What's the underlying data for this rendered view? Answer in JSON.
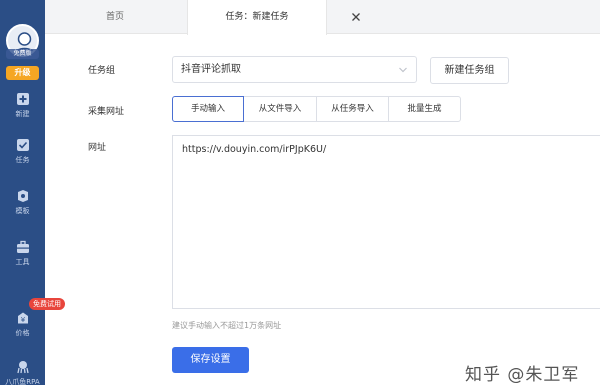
{
  "sidebar": {
    "avatar_tag": "免费版",
    "upgrade_label": "升级",
    "items": [
      {
        "label": "新建",
        "icon": "plus-square-icon"
      },
      {
        "label": "任务",
        "icon": "task-check-icon"
      },
      {
        "label": "模板",
        "icon": "template-icon"
      },
      {
        "label": "工具",
        "icon": "toolbox-icon"
      },
      {
        "label": "价格",
        "icon": "price-icon"
      },
      {
        "label": "八爪鱼RPA",
        "icon": "rpa-octopus-icon"
      }
    ],
    "free_trial_badge": "免费试用"
  },
  "tabs": {
    "home": "首页",
    "active": "任务：新建任务",
    "close_icon": "close-icon"
  },
  "form": {
    "task_group_label": "任务组",
    "task_group_value": "抖音评论抓取",
    "new_group_button": "新建任务组",
    "collect_url_label": "采集网址",
    "input_modes": [
      "手动输入",
      "从文件导入",
      "从任务导入",
      "批量生成"
    ],
    "active_mode": "手动输入",
    "url_label": "网址",
    "url_value": "https://v.douyin.com/irPJpK6U/",
    "hint": "建议手动输入不超过1万条网址",
    "save_button": "保存设置"
  },
  "watermark": "知乎 @朱卫军",
  "colors": {
    "sidebar_bg": "#2b4e86",
    "primary": "#3a6ee8",
    "upgrade": "#f5a623",
    "badge": "#e8453c"
  }
}
